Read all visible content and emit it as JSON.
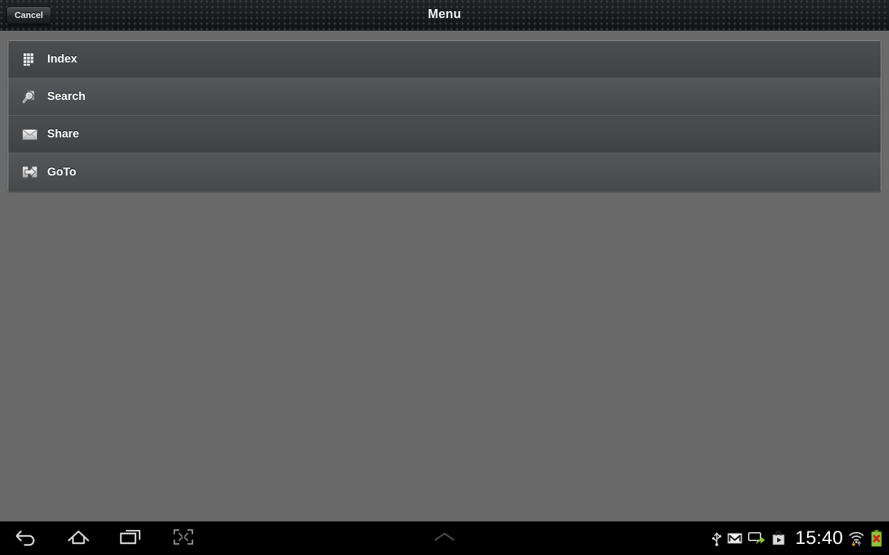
{
  "titlebar": {
    "title": "Menu",
    "cancel_label": "Cancel"
  },
  "menu": {
    "items": [
      {
        "label": "Index",
        "icon": "grid-icon"
      },
      {
        "label": "Search",
        "icon": "magnifier-icon"
      },
      {
        "label": "Share",
        "icon": "envelope-icon"
      },
      {
        "label": "GoTo",
        "icon": "goto-arrow-icon"
      }
    ]
  },
  "navbar": {
    "buttons": [
      {
        "name": "back-button",
        "icon": "back-arrow-icon"
      },
      {
        "name": "home-button",
        "icon": "home-icon"
      },
      {
        "name": "recent-apps-button",
        "icon": "recent-apps-icon"
      },
      {
        "name": "screenshot-button",
        "icon": "screenshot-icon"
      }
    ],
    "shade_handle": {
      "icon": "chevron-up-icon"
    },
    "status": {
      "clock": "15:40",
      "icons": [
        {
          "name": "usb-icon"
        },
        {
          "name": "gmail-icon"
        },
        {
          "name": "system-update-icon"
        },
        {
          "name": "play-store-icon"
        },
        {
          "name": "wifi-icon"
        },
        {
          "name": "battery-error-icon"
        }
      ]
    }
  },
  "colors": {
    "titlebar_bg": "#1a1d20",
    "panel_bg": "#474a4c",
    "desktop_bg": "#6a6a6a",
    "navbar_bg": "#000000",
    "accent_green": "#8cc63e",
    "accent_red": "#d32020",
    "text_primary": "#ffffff"
  }
}
